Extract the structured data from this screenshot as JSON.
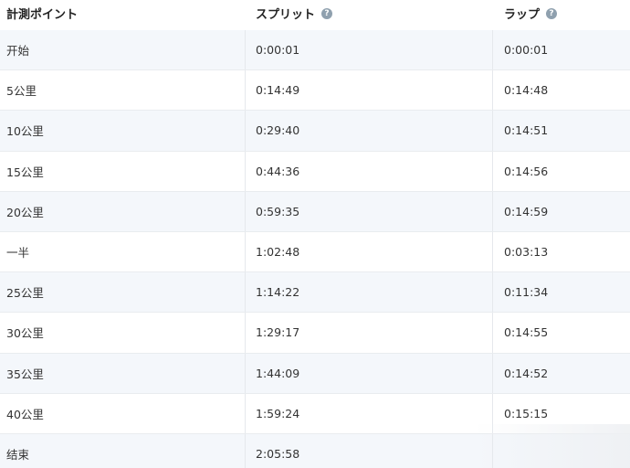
{
  "headers": {
    "point": "計測ポイント",
    "split": "スプリット",
    "lap": "ラップ",
    "help_glyph": "?"
  },
  "rows": [
    {
      "point": "开始",
      "split": "0:00:01",
      "lap": "0:00:01"
    },
    {
      "point": "5公里",
      "split": "0:14:49",
      "lap": "0:14:48"
    },
    {
      "point": "10公里",
      "split": "0:29:40",
      "lap": "0:14:51"
    },
    {
      "point": "15公里",
      "split": "0:44:36",
      "lap": "0:14:56"
    },
    {
      "point": "20公里",
      "split": "0:59:35",
      "lap": "0:14:59"
    },
    {
      "point": "一半",
      "split": "1:02:48",
      "lap": "0:03:13"
    },
    {
      "point": "25公里",
      "split": "1:14:22",
      "lap": "0:11:34"
    },
    {
      "point": "30公里",
      "split": "1:29:17",
      "lap": "0:14:55"
    },
    {
      "point": "35公里",
      "split": "1:44:09",
      "lap": "0:14:52"
    },
    {
      "point": "40公里",
      "split": "1:59:24",
      "lap": "0:15:15"
    },
    {
      "point": "结束",
      "split": "2:05:58",
      "lap": ""
    }
  ]
}
